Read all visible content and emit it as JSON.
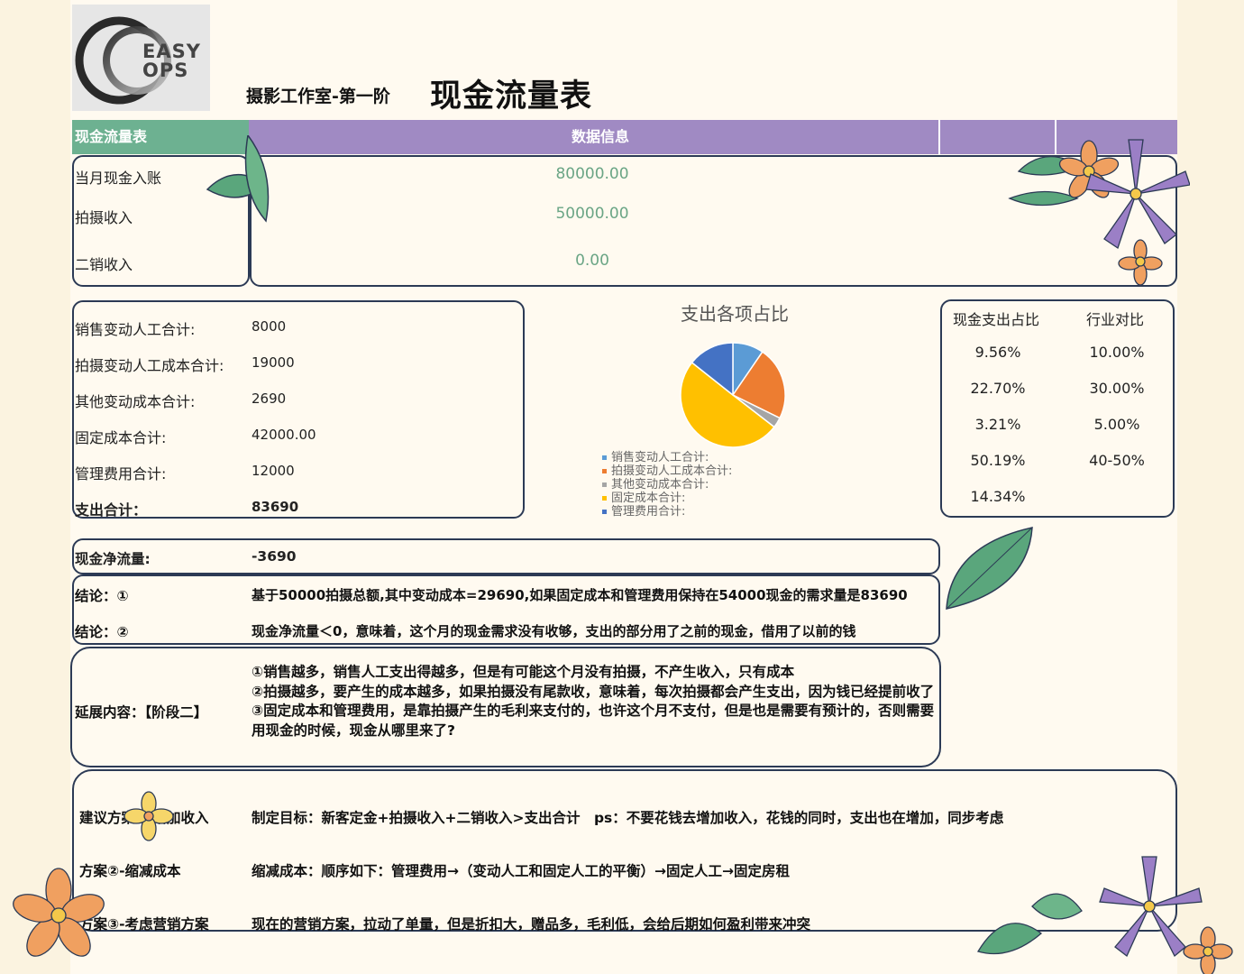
{
  "logo": {
    "line1": "EASY",
    "line2": "OPS"
  },
  "header": {
    "subtitle": "摄影工作室-第一阶",
    "title": "现金流量表"
  },
  "table_header": {
    "left": "现金流量表",
    "right": "数据信息"
  },
  "income": [
    {
      "label": "当月现金入账",
      "value": "80000.00"
    },
    {
      "label": "拍摄收入",
      "value": "50000.00"
    },
    {
      "label": "二销收入",
      "value": "0.00"
    }
  ],
  "costs": [
    {
      "label": "销售变动人工合计:",
      "value": "8000"
    },
    {
      "label": "拍摄变动人工成本合计:",
      "value": "19000"
    },
    {
      "label": "其他变动成本合计:",
      "value": "2690"
    },
    {
      "label": "固定成本合计:",
      "value": "42000.00"
    },
    {
      "label": "管理费用合计:",
      "value": "12000"
    },
    {
      "label": "支出合计：",
      "value": "83690"
    }
  ],
  "ratios": {
    "col1": "现金支出占比",
    "col2": "行业对比",
    "cash": [
      "9.56%",
      "22.70%",
      "3.21%",
      "50.19%",
      "14.34%"
    ],
    "industry": [
      "10.00%",
      "30.00%",
      "5.00%",
      "40-50%"
    ]
  },
  "chart_data": {
    "type": "pie",
    "title": "支出各项占比",
    "categories": [
      "销售变动人工合计:",
      "拍摄变动人工成本合计:",
      "其他变动成本合计:",
      "固定成本合计:",
      "管理费用合计:"
    ],
    "values": [
      8000,
      19000,
      2690,
      42000,
      12000
    ],
    "colors": [
      "#5b9bd5",
      "#ed7d31",
      "#a5a5a5",
      "#ffc000",
      "#4472c4"
    ],
    "legend_position": "bottom"
  },
  "net": {
    "label": "现金净流量:",
    "value": "-3690"
  },
  "conclusions": [
    {
      "label": "结论：①",
      "text": "基于50000拍摄总额,其中变动成本=29690,如果固定成本和管理费用保持在54000现金的需求量是83690"
    },
    {
      "label": "结论：②",
      "text": "现金净流量＜0，意味着，这个月的现金需求没有收够，支出的部分用了之前的现金，借用了以前的钱"
    }
  ],
  "extension": {
    "label": "延展内容：【阶段二】",
    "text": "①销售越多，销售人工支出得越多，但是有可能这个月没有拍摄，不产生收入，只有成本\n②拍摄越多，要产生的成本越多，如果拍摄没有尾款收，意味着，每次拍摄都会产生支出，因为钱已经提前收了\n③固定成本和管理费用，是靠拍摄产生的毛利来支付的，也许这个月不支付，但是也是需要有预计的，否则需要用现金的时候，现金从哪里来了?"
  },
  "plans": [
    {
      "label": "建议方案①-增加收入",
      "text": "制定目标：新客定金+拍摄收入+二销收入>支出合计　ps：不要花钱去增加收入，花钱的同时，支出也在增加，同步考虑"
    },
    {
      "label": "方案②-缩减成本",
      "text": "缩减成本：顺序如下：管理费用→（变动人工和固定人工的平衡）→固定人工→固定房租"
    },
    {
      "label": "方案③-考虑营销方案",
      "text": "现在的营销方案，拉动了单量，但是折扣大，赠品多，毛利低，会给后期如何盈利带来冲突"
    }
  ]
}
